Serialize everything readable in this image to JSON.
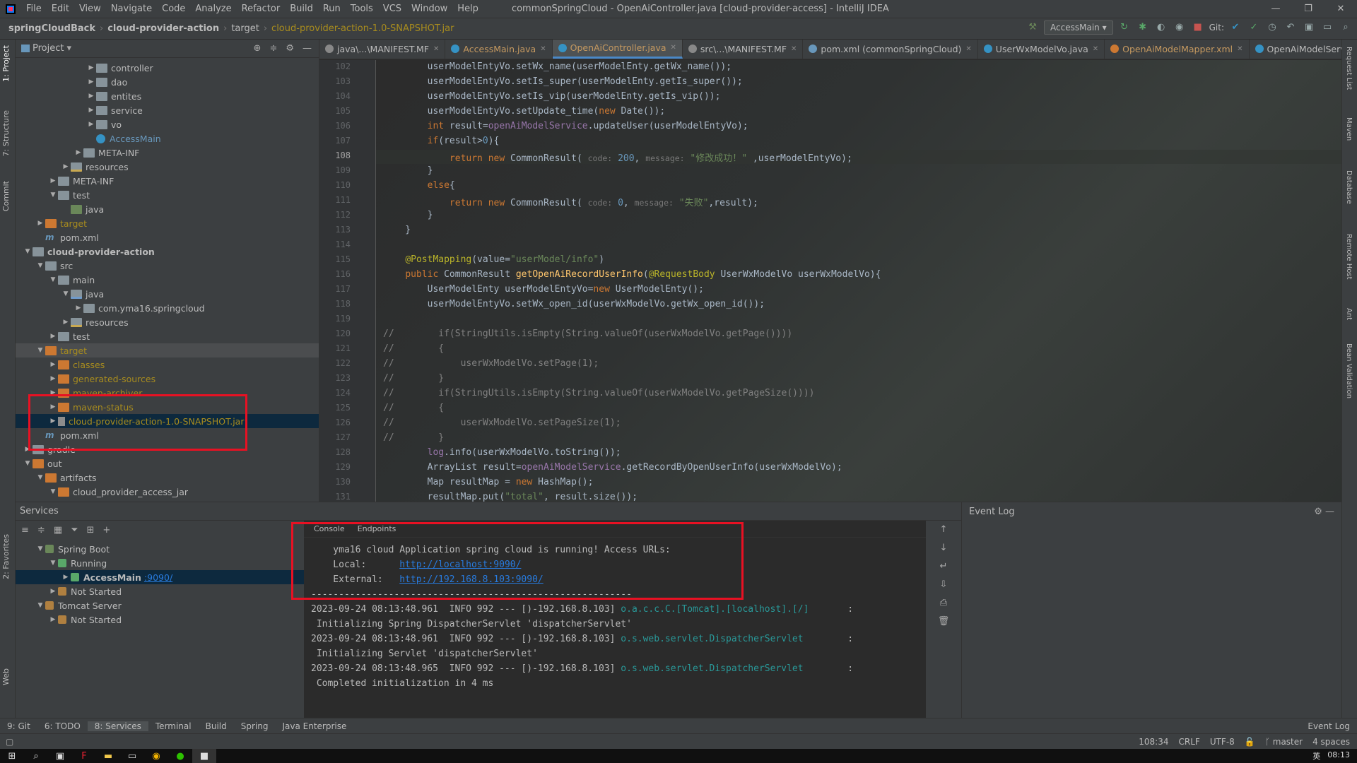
{
  "menu": {
    "items": [
      "File",
      "Edit",
      "View",
      "Navigate",
      "Code",
      "Analyze",
      "Refactor",
      "Build",
      "Run",
      "Tools",
      "VCS",
      "Window",
      "Help"
    ],
    "window_title": "commonSpringCloud - OpenAiController.java [cloud-provider-access] - IntelliJ IDEA"
  },
  "navbar": {
    "crumbs": [
      "springCloudBack",
      "cloud-provider-action",
      "target",
      "cloud-provider-action-1.0-SNAPSHOT.jar"
    ],
    "run_config": "AccessMain",
    "git_label": "Git:"
  },
  "project": {
    "title": "Project",
    "rows": [
      {
        "label": "controller",
        "indent": 6,
        "type": "folder",
        "arrow": "▶"
      },
      {
        "label": "dao",
        "indent": 6,
        "type": "folder",
        "arrow": "▶"
      },
      {
        "label": "entites",
        "indent": 6,
        "type": "folder",
        "arrow": "▶"
      },
      {
        "label": "service",
        "indent": 6,
        "type": "folder",
        "arrow": "▶"
      },
      {
        "label": "vo",
        "indent": 6,
        "type": "folder",
        "arrow": "▶"
      },
      {
        "label": "AccessMain",
        "indent": 6,
        "type": "class",
        "arrow": "",
        "color": "blue"
      },
      {
        "label": "META-INF",
        "indent": 5,
        "type": "folder",
        "arrow": "▶"
      },
      {
        "label": "resources",
        "indent": 4,
        "type": "res",
        "arrow": "▶"
      },
      {
        "label": "META-INF",
        "indent": 3,
        "type": "folder",
        "arrow": "▶"
      },
      {
        "label": "test",
        "indent": 3,
        "type": "folder",
        "arrow": "▼"
      },
      {
        "label": "java",
        "indent": 4,
        "type": "test",
        "arrow": ""
      },
      {
        "label": "target",
        "indent": 2,
        "type": "or",
        "arrow": "▶",
        "color": "orange"
      },
      {
        "label": "pom.xml",
        "indent": 2,
        "type": "pom",
        "arrow": ""
      },
      {
        "label": "cloud-provider-action",
        "indent": 1,
        "type": "module",
        "arrow": "▼",
        "bold": true
      },
      {
        "label": "src",
        "indent": 2,
        "type": "folder",
        "arrow": "▼"
      },
      {
        "label": "main",
        "indent": 3,
        "type": "folder",
        "arrow": "▼"
      },
      {
        "label": "java",
        "indent": 4,
        "type": "src",
        "arrow": "▼"
      },
      {
        "label": "com.yma16.springcloud",
        "indent": 5,
        "type": "folder",
        "arrow": "▶"
      },
      {
        "label": "resources",
        "indent": 4,
        "type": "res",
        "arrow": "▶"
      },
      {
        "label": "test",
        "indent": 3,
        "type": "folder",
        "arrow": "▶"
      },
      {
        "label": "target",
        "indent": 2,
        "type": "or",
        "arrow": "▼",
        "color": "orange",
        "sel2": true
      },
      {
        "label": "classes",
        "indent": 3,
        "type": "or",
        "arrow": "▶",
        "color": "orange"
      },
      {
        "label": "generated-sources",
        "indent": 3,
        "type": "or",
        "arrow": "▶",
        "color": "orange"
      },
      {
        "label": "maven-archiver",
        "indent": 3,
        "type": "or",
        "arrow": "▶",
        "color": "orange"
      },
      {
        "label": "maven-status",
        "indent": 3,
        "type": "or",
        "arrow": "▶",
        "color": "orange"
      },
      {
        "label": "cloud-provider-action-1.0-SNAPSHOT.jar",
        "indent": 3,
        "type": "jar",
        "arrow": "▶",
        "color": "orange",
        "sel": true
      },
      {
        "label": "pom.xml",
        "indent": 2,
        "type": "pom",
        "arrow": ""
      },
      {
        "label": "gradle",
        "indent": 1,
        "type": "folder",
        "arrow": "▶"
      },
      {
        "label": "out",
        "indent": 1,
        "type": "or",
        "arrow": "▼"
      },
      {
        "label": "artifacts",
        "indent": 2,
        "type": "or",
        "arrow": "▼"
      },
      {
        "label": "cloud_provider_access_jar",
        "indent": 3,
        "type": "or",
        "arrow": "▼"
      }
    ]
  },
  "tabs": [
    {
      "label": "java\\...\\MANIFEST.MF",
      "icon": "#888888"
    },
    {
      "label": "AccessMain.java",
      "icon": "#3592c4",
      "orange": true
    },
    {
      "label": "OpenAiController.java",
      "icon": "#3592c4",
      "active": true,
      "orange": true
    },
    {
      "label": "src\\...\\MANIFEST.MF",
      "icon": "#888888"
    },
    {
      "label": "pom.xml (commonSpringCloud)",
      "icon": "#6897bb"
    },
    {
      "label": "UserWxModelVo.java",
      "icon": "#3592c4"
    },
    {
      "label": "OpenAiModelMapper.xml",
      "icon": "#cc7832",
      "orange": true
    },
    {
      "label": "OpenAiModelServic",
      "icon": "#3592c4"
    }
  ],
  "code": {
    "current_line": 108,
    "lines": [
      {
        "n": 102,
        "html": "        userModelEntyVo.setWx_name(userModelEnty.getWx_name());"
      },
      {
        "n": 103,
        "html": "        userModelEntyVo.setIs_super(userModelEnty.getIs_super());"
      },
      {
        "n": 104,
        "html": "        userModelEntyVo.setIs_vip(userModelEnty.getIs_vip());"
      },
      {
        "n": 105,
        "html": "        userModelEntyVo.setUpdate_time(<span class=\"kw\">new</span> Date());"
      },
      {
        "n": 106,
        "html": "        <span class=\"kw\">int</span> result=<span class=\"fld\">openAiModelService</span>.updateUser(userModelEntyVo);"
      },
      {
        "n": 107,
        "html": "        <span class=\"kw\">if</span>(result><span class=\"num\">0</span>){"
      },
      {
        "n": 108,
        "html": "            <span class=\"kw\">return new</span> CommonResult( <span class=\"hint\">code:</span> <span class=\"num\">200</span>, <span class=\"hint\">message:</span> <span class=\"str\">\"修改成功！\"</span> ,userModelEntyVo);"
      },
      {
        "n": 109,
        "html": "        }"
      },
      {
        "n": 110,
        "html": "        <span class=\"kw\">else</span>{"
      },
      {
        "n": 111,
        "html": "            <span class=\"kw\">return new</span> CommonResult( <span class=\"hint\">code:</span> <span class=\"num\">0</span>, <span class=\"hint\">message:</span> <span class=\"str\">\"失败\"</span>,result);"
      },
      {
        "n": 112,
        "html": "        }"
      },
      {
        "n": 113,
        "html": "    }"
      },
      {
        "n": 114,
        "html": ""
      },
      {
        "n": 115,
        "html": "    <span class=\"ann\">@PostMapping</span>(value=<span class=\"str\">\"userModel/info\"</span>)"
      },
      {
        "n": 116,
        "html": "    <span class=\"kw\">public</span> CommonResult <span class=\"fn\">getOpenAiRecordUserInfo</span>(<span class=\"ann\">@RequestBody</span> UserWxModelVo userWxModelVo){"
      },
      {
        "n": 117,
        "html": "        UserModelEnty userModelEntyVo=<span class=\"kw\">new</span> UserModelEnty();"
      },
      {
        "n": 118,
        "html": "        userModelEntyVo.setWx_open_id(userWxModelVo.getWx_open_id());"
      },
      {
        "n": 119,
        "html": ""
      },
      {
        "n": 120,
        "html": "<span class=\"cmt\">//        if(StringUtils.isEmpty(String.valueOf(userWxModelVo.getPage())))</span>"
      },
      {
        "n": 121,
        "html": "<span class=\"cmt\">//        {</span>"
      },
      {
        "n": 122,
        "html": "<span class=\"cmt\">//            userWxModelVo.setPage(1);</span>"
      },
      {
        "n": 123,
        "html": "<span class=\"cmt\">//        }</span>"
      },
      {
        "n": 124,
        "html": "<span class=\"cmt\">//        if(StringUtils.isEmpty(String.valueOf(userWxModelVo.getPageSize())))</span>"
      },
      {
        "n": 125,
        "html": "<span class=\"cmt\">//        {</span>"
      },
      {
        "n": 126,
        "html": "<span class=\"cmt\">//            userWxModelVo.setPageSize(1);</span>"
      },
      {
        "n": 127,
        "html": "<span class=\"cmt\">//        }</span>"
      },
      {
        "n": 128,
        "html": "        <span class=\"fld\">log</span>.info(userWxModelVo.toString());"
      },
      {
        "n": 129,
        "html": "        ArrayList<UserModelEnty> result=<span class=\"fld\">openAiModelService</span>.getRecordByOpenUserInfo(userWxModelVo);"
      },
      {
        "n": 130,
        "html": "        Map resultMap = <span class=\"kw\">new</span> HashMap();"
      },
      {
        "n": 131,
        "html": "        resultMap.put(<span class=\"str\">\"total\"</span>, result.size());"
      }
    ]
  },
  "services": {
    "title": "Services",
    "tree": [
      {
        "label": "Spring Boot",
        "indent": 1,
        "arrow": "▼"
      },
      {
        "label": "Running",
        "indent": 2,
        "arrow": "▼"
      },
      {
        "label": "AccessMain",
        "port": ":9090/",
        "indent": 3,
        "arrow": "▶",
        "sel": true
      },
      {
        "label": "Not Started",
        "indent": 2,
        "arrow": "▶"
      },
      {
        "label": "Tomcat Server",
        "indent": 1,
        "arrow": "▼"
      },
      {
        "label": "Not Started",
        "indent": 2,
        "arrow": "▶"
      }
    ],
    "console_tabs": [
      "Console",
      "Endpoints"
    ],
    "console_lines": [
      {
        "html": "    yma16 cloud Application spring cloud is running! Access URLs:"
      },
      {
        "html": "    Local:      <span class=\"link\">http://localhost:9090/</span>"
      },
      {
        "html": "    External:   <span class=\"link\">http://192.168.8.103:9090/</span>"
      },
      {
        "html": "----------------------------------------------------------"
      },
      {
        "html": "2023-09-24 08:13:48.961  INFO 992 --- [)-192.168.8.103] <span class=\"teal\">o.a.c.c.C.[Tomcat].[localhost].[/]</span>       :"
      },
      {
        "html": " Initializing Spring DispatcherServlet 'dispatcherServlet'"
      },
      {
        "html": "2023-09-24 08:13:48.961  INFO 992 --- [)-192.168.8.103] <span class=\"teal\">o.s.web.servlet.DispatcherServlet</span>        :"
      },
      {
        "html": " Initializing Servlet 'dispatcherServlet'"
      },
      {
        "html": "2023-09-24 08:13:48.965  INFO 992 --- [)-192.168.8.103] <span class=\"teal\">o.s.web.servlet.DispatcherServlet</span>        :"
      },
      {
        "html": " Completed initialization in 4 ms"
      }
    ],
    "event_log": "Event Log"
  },
  "bottom_tabs": [
    "9: Git",
    "6: TODO",
    "8: Services",
    "Terminal",
    "Build",
    "Spring",
    "Java Enterprise"
  ],
  "bottom_active": "8: Services",
  "event_log_btn": "Event Log",
  "status": {
    "position": "108:34",
    "line_sep": "CRLF",
    "encoding": "UTF-8",
    "branch": "master",
    "indent": "4 spaces"
  },
  "left_tabs": [
    "1: Project",
    "7: Structure",
    "Commit",
    "2: Favorites",
    "Web"
  ],
  "right_tabs": [
    "Request List",
    "Maven",
    "Database",
    "Remote Host",
    "Ant",
    "Bean Validation"
  ],
  "taskbar": {
    "ime": "英",
    "time": "08:13"
  }
}
